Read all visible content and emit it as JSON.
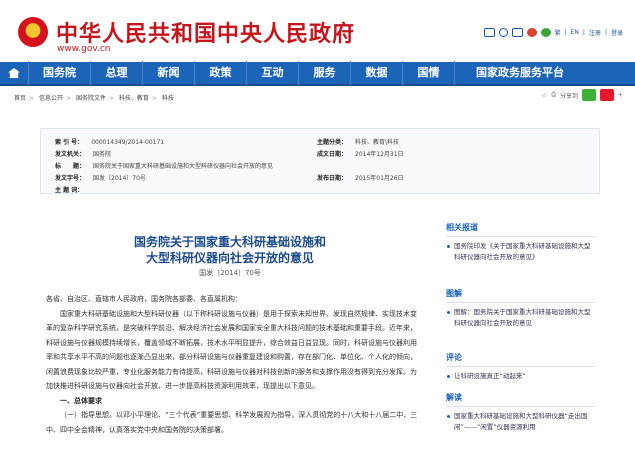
{
  "header": {
    "title": "中华人民共和国中央人民政府",
    "url": "www.gov.cn",
    "tools": [
      "繁",
      "EN",
      "注册",
      "登录"
    ]
  },
  "nav": {
    "items": [
      "国务院",
      "总理",
      "新闻",
      "政策",
      "互动",
      "服务",
      "数据",
      "国情",
      "国家政务服务平台"
    ]
  },
  "breadcrumb": [
    "首页",
    "信息公开",
    "国务院文件",
    "科技、教育",
    "科技"
  ],
  "share": {
    "label": "分享到"
  },
  "info": {
    "index_label": "索 引 号：",
    "index_value": "000014349/2014-00171",
    "category_label": "主题分类：",
    "category_value": "科技、教育\\科技",
    "issuer_label": "发文机关：",
    "issuer_value": "国务院",
    "date_label": "成文日期：",
    "date_value": "2014年12月31日",
    "title_label": "标　　题：",
    "title_value": "国务院关于国家重大科研基础设施和大型科研仪器向社会开放的意见",
    "docno_label": "发文字号：",
    "docno_value": "国发〔2014〕70号",
    "pubdate_label": "发布日期：",
    "pubdate_value": "2015年01月26日",
    "keyword_label": "主 题 词："
  },
  "document": {
    "title_line1": "国务院关于国家重大科研基础设施和",
    "title_line2": "大型科研仪器向社会开放的意见",
    "doc_no": "国发〔2014〕70号",
    "salutation": "各省、自治区、直辖市人民政府，国务院各部委、各直属机构：",
    "para1": "国家重大科研基础设施和大型科研仪器（以下称科研设施与仪器）是用于探索未知世界、发现自然规律、实现技术变革的复杂科学研究系统，是突破科学前沿、解决经济社会发展和国家安全重大科技问题的技术基础和重要手段。近年来，科研设施与仪器规模持续增长，覆盖领域不断拓展，技术水平明显提升，综合效益日益显现。同时，科研设施与仪器利用率和共享水平不高的问题也逐渐凸显出来，部分科研设施与仪器重复建设和购置，存在部门化、单位化、个人化的倾向，闲置浪费现象比较严重，专业化服务能力有待提高，科研设施与仪器对科技创新的服务和支撑作用没有得到充分发挥。为加快推进科研设施与仪器向社会开放，进一步提高科技资源利用效率，现提出以下意见。",
    "section1": "一、总体要求",
    "para2": "（一）指导思想。以邓小平理论、“三个代表”重要思想、科学发展观为指导，深入贯彻党的十八大和十八届二中、三中、四中全会精神，认真落实党中央和国务院的决策部署。"
  },
  "sidebar": {
    "related_head": "相关报道",
    "related_links": [
      "国务院印发《关于国家重大科研基础设施和大型科研仪器向社会开放的意见》"
    ],
    "illustration_head": "图解",
    "illustration_links": [
      "图解：国务院关于国家重大科研基础设施和大型科研仪器向社会开放的意见"
    ],
    "comment_head": "评论",
    "comment_links": [
      "让科研设施真正“动起来”"
    ],
    "interpretation_head": "解读",
    "interpretation_links": [
      "国家重大科研基础设施和大型科研仪器“走出国闲”——“闲置”仪器资源利用"
    ]
  },
  "colors": {
    "brand_red": "#c4161c",
    "nav_blue": "#1c64b8",
    "title_blue": "#1c4c8a"
  }
}
